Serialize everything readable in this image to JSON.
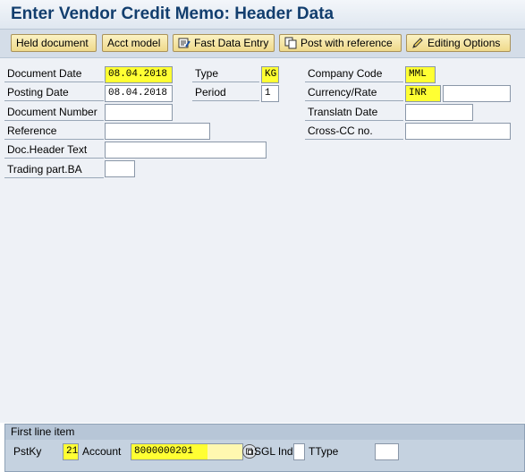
{
  "page": {
    "title": "Enter Vendor Credit Memo: Header Data"
  },
  "toolbar": {
    "held_document": "Held document",
    "acct_model": "Acct model",
    "fast_data_entry": "Fast Data Entry",
    "post_with_reference": "Post with reference",
    "editing_options": "Editing Options"
  },
  "header": {
    "document_date": {
      "label": "Document Date",
      "value": "08.04.2018"
    },
    "posting_date": {
      "label": "Posting Date",
      "value": "08.04.2018"
    },
    "document_number": {
      "label": "Document Number",
      "value": ""
    },
    "reference": {
      "label": "Reference",
      "value": ""
    },
    "doc_header_text": {
      "label": "Doc.Header Text",
      "value": ""
    },
    "trading_part_ba": {
      "label": "Trading part.BA",
      "value": ""
    },
    "type": {
      "label": "Type",
      "value": "KG"
    },
    "period": {
      "label": "Period",
      "value": "1"
    },
    "company_code": {
      "label": "Company Code",
      "value": "MML"
    },
    "currency_rate": {
      "label": "Currency/Rate",
      "value": "INR",
      "rate": ""
    },
    "translatn_date": {
      "label": "Translatn Date",
      "value": ""
    },
    "cross_cc_no": {
      "label": "Cross-CC no.",
      "value": ""
    }
  },
  "first_line_item": {
    "title": "First line item",
    "pstky": {
      "label": "PstKy",
      "value": "21"
    },
    "account": {
      "label": "Account",
      "value": "8000000201"
    },
    "sgl_ind": {
      "label": "SGL Ind",
      "value": ""
    },
    "ttype": {
      "label": "TType",
      "value": ""
    }
  },
  "colors": {
    "highlight": "#ffff33",
    "title": "#123e6e",
    "toolbar": "#d4dde8"
  }
}
